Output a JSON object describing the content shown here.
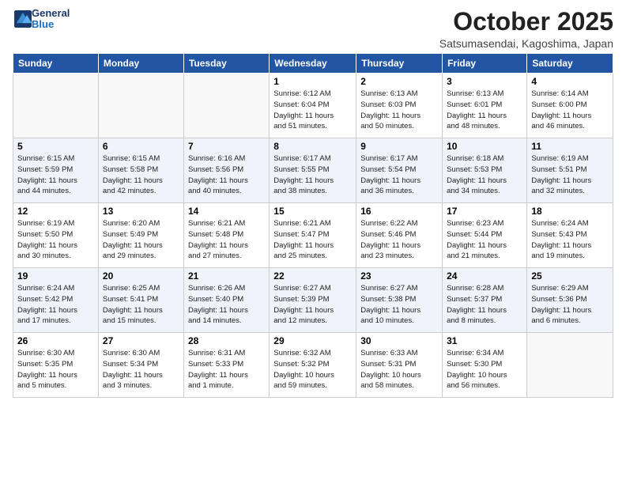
{
  "header": {
    "logo_general": "General",
    "logo_blue": "Blue",
    "title": "October 2025",
    "location": "Satsumasendai, Kagoshima, Japan"
  },
  "weekdays": [
    "Sunday",
    "Monday",
    "Tuesday",
    "Wednesday",
    "Thursday",
    "Friday",
    "Saturday"
  ],
  "weeks": [
    [
      {
        "day": "",
        "info": ""
      },
      {
        "day": "",
        "info": ""
      },
      {
        "day": "",
        "info": ""
      },
      {
        "day": "1",
        "info": "Sunrise: 6:12 AM\nSunset: 6:04 PM\nDaylight: 11 hours\nand 51 minutes."
      },
      {
        "day": "2",
        "info": "Sunrise: 6:13 AM\nSunset: 6:03 PM\nDaylight: 11 hours\nand 50 minutes."
      },
      {
        "day": "3",
        "info": "Sunrise: 6:13 AM\nSunset: 6:01 PM\nDaylight: 11 hours\nand 48 minutes."
      },
      {
        "day": "4",
        "info": "Sunrise: 6:14 AM\nSunset: 6:00 PM\nDaylight: 11 hours\nand 46 minutes."
      }
    ],
    [
      {
        "day": "5",
        "info": "Sunrise: 6:15 AM\nSunset: 5:59 PM\nDaylight: 11 hours\nand 44 minutes."
      },
      {
        "day": "6",
        "info": "Sunrise: 6:15 AM\nSunset: 5:58 PM\nDaylight: 11 hours\nand 42 minutes."
      },
      {
        "day": "7",
        "info": "Sunrise: 6:16 AM\nSunset: 5:56 PM\nDaylight: 11 hours\nand 40 minutes."
      },
      {
        "day": "8",
        "info": "Sunrise: 6:17 AM\nSunset: 5:55 PM\nDaylight: 11 hours\nand 38 minutes."
      },
      {
        "day": "9",
        "info": "Sunrise: 6:17 AM\nSunset: 5:54 PM\nDaylight: 11 hours\nand 36 minutes."
      },
      {
        "day": "10",
        "info": "Sunrise: 6:18 AM\nSunset: 5:53 PM\nDaylight: 11 hours\nand 34 minutes."
      },
      {
        "day": "11",
        "info": "Sunrise: 6:19 AM\nSunset: 5:51 PM\nDaylight: 11 hours\nand 32 minutes."
      }
    ],
    [
      {
        "day": "12",
        "info": "Sunrise: 6:19 AM\nSunset: 5:50 PM\nDaylight: 11 hours\nand 30 minutes."
      },
      {
        "day": "13",
        "info": "Sunrise: 6:20 AM\nSunset: 5:49 PM\nDaylight: 11 hours\nand 29 minutes."
      },
      {
        "day": "14",
        "info": "Sunrise: 6:21 AM\nSunset: 5:48 PM\nDaylight: 11 hours\nand 27 minutes."
      },
      {
        "day": "15",
        "info": "Sunrise: 6:21 AM\nSunset: 5:47 PM\nDaylight: 11 hours\nand 25 minutes."
      },
      {
        "day": "16",
        "info": "Sunrise: 6:22 AM\nSunset: 5:46 PM\nDaylight: 11 hours\nand 23 minutes."
      },
      {
        "day": "17",
        "info": "Sunrise: 6:23 AM\nSunset: 5:44 PM\nDaylight: 11 hours\nand 21 minutes."
      },
      {
        "day": "18",
        "info": "Sunrise: 6:24 AM\nSunset: 5:43 PM\nDaylight: 11 hours\nand 19 minutes."
      }
    ],
    [
      {
        "day": "19",
        "info": "Sunrise: 6:24 AM\nSunset: 5:42 PM\nDaylight: 11 hours\nand 17 minutes."
      },
      {
        "day": "20",
        "info": "Sunrise: 6:25 AM\nSunset: 5:41 PM\nDaylight: 11 hours\nand 15 minutes."
      },
      {
        "day": "21",
        "info": "Sunrise: 6:26 AM\nSunset: 5:40 PM\nDaylight: 11 hours\nand 14 minutes."
      },
      {
        "day": "22",
        "info": "Sunrise: 6:27 AM\nSunset: 5:39 PM\nDaylight: 11 hours\nand 12 minutes."
      },
      {
        "day": "23",
        "info": "Sunrise: 6:27 AM\nSunset: 5:38 PM\nDaylight: 11 hours\nand 10 minutes."
      },
      {
        "day": "24",
        "info": "Sunrise: 6:28 AM\nSunset: 5:37 PM\nDaylight: 11 hours\nand 8 minutes."
      },
      {
        "day": "25",
        "info": "Sunrise: 6:29 AM\nSunset: 5:36 PM\nDaylight: 11 hours\nand 6 minutes."
      }
    ],
    [
      {
        "day": "26",
        "info": "Sunrise: 6:30 AM\nSunset: 5:35 PM\nDaylight: 11 hours\nand 5 minutes."
      },
      {
        "day": "27",
        "info": "Sunrise: 6:30 AM\nSunset: 5:34 PM\nDaylight: 11 hours\nand 3 minutes."
      },
      {
        "day": "28",
        "info": "Sunrise: 6:31 AM\nSunset: 5:33 PM\nDaylight: 11 hours\nand 1 minute."
      },
      {
        "day": "29",
        "info": "Sunrise: 6:32 AM\nSunset: 5:32 PM\nDaylight: 10 hours\nand 59 minutes."
      },
      {
        "day": "30",
        "info": "Sunrise: 6:33 AM\nSunset: 5:31 PM\nDaylight: 10 hours\nand 58 minutes."
      },
      {
        "day": "31",
        "info": "Sunrise: 6:34 AM\nSunset: 5:30 PM\nDaylight: 10 hours\nand 56 minutes."
      },
      {
        "day": "",
        "info": ""
      }
    ]
  ]
}
